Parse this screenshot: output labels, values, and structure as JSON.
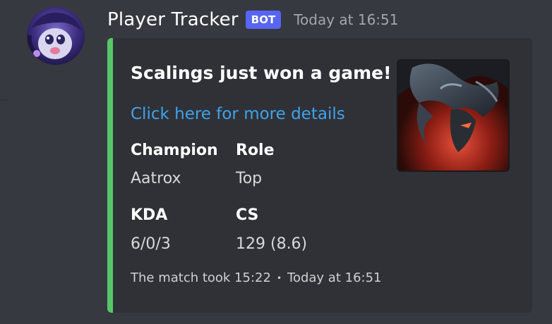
{
  "message": {
    "author": "Player Tracker",
    "bot_tag": "BOT",
    "timestamp": "Today at 16:51"
  },
  "embed": {
    "accent_color": "#57c769",
    "title": "Scalings just won a game!",
    "link_text": "Click here for more details",
    "fields": [
      {
        "name": "Champion",
        "value": "Aatrox"
      },
      {
        "name": "Role",
        "value": "Top"
      },
      {
        "name": "KDA",
        "value": "6/0/3"
      },
      {
        "name": "CS",
        "value": "129 (8.6)"
      }
    ],
    "footer": {
      "text": "The match took 15:22",
      "separator": "•",
      "timestamp": "Today at 16:51"
    },
    "thumbnail": "champion-portrait-aatrox"
  },
  "colors": {
    "background": "#36393f",
    "embed_background": "#2f3136",
    "link": "#3fa3ec",
    "bot_badge": "#5865f2"
  }
}
